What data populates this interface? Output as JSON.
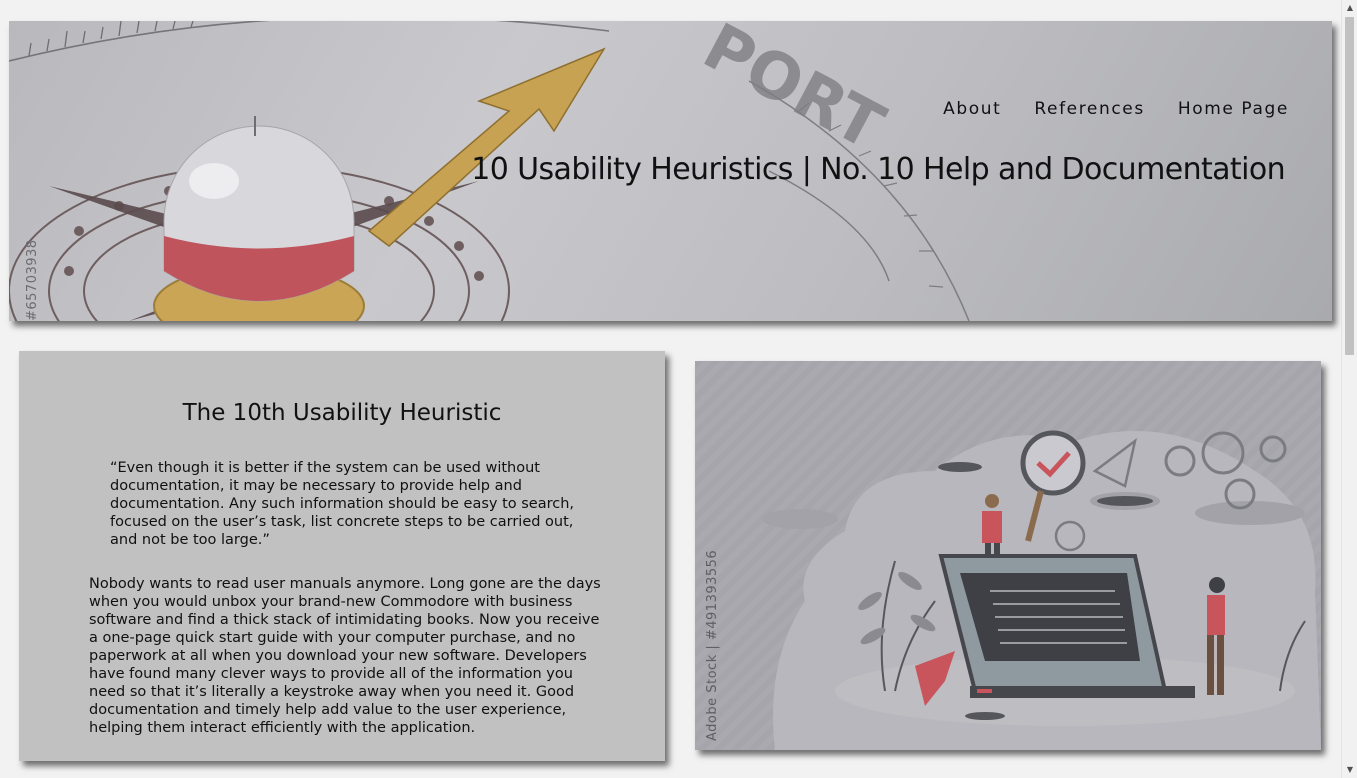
{
  "nav": {
    "items": [
      {
        "label": "About"
      },
      {
        "label": "References"
      },
      {
        "label": "Home Page"
      }
    ]
  },
  "hero": {
    "title": "10 Usability Heuristics | No. 10 Help and Documentation",
    "stock_id": "#65703938",
    "dial_text": "PORT"
  },
  "card": {
    "heading": "The 10th Usability Heuristic",
    "quote": "“Even though it is better if the system can be used without documentation, it may be necessary to provide help and documentation. Any such information should be easy to search, focused on the user’s task, list concrete steps to be carried out, and not be too large.”",
    "body": "Nobody wants to read user manuals anymore. Long gone are the days when you would unbox your brand-new Commodore with business software and find a thick stack of intimidating books. Now you receive a one-page quick start guide with your computer purchase, and no paperwork at all when you download your new software. Developers have found many clever ways to provide all of the information you need so that it’s literally a keystroke away when you need it. Good documentation and timely help add value to the user experience, helping them interact efficiently with the application."
  },
  "illustration": {
    "stock_id": "Adobe Stock | #491393556"
  },
  "colors": {
    "page_bg": "#f2f2f2",
    "card_bg": "#c1c1c1",
    "accent_red": "#c9555c",
    "arrow_gold": "#c8a253"
  }
}
